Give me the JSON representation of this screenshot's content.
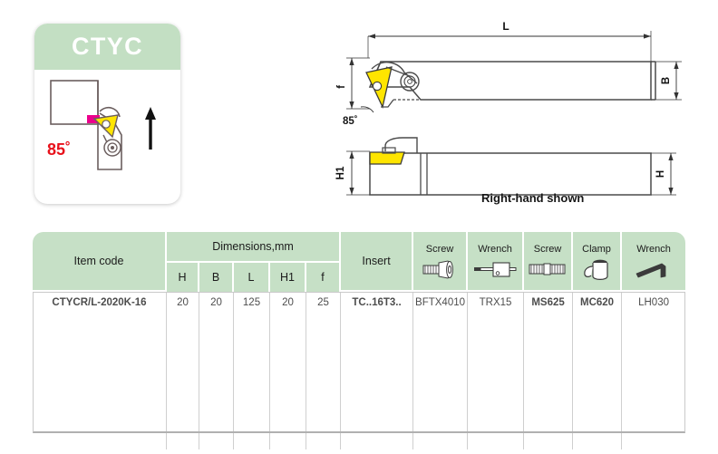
{
  "product": {
    "code_badge": "CTYC",
    "lead_angle": "85˚",
    "view_caption": "Right-hand shown",
    "drawing_angle_label": "85˚"
  },
  "drawing_labels": {
    "length": "L",
    "width": "B",
    "height": "H",
    "height1": "H1",
    "f": "f"
  },
  "table": {
    "header": {
      "item_code": "Item code",
      "dimensions_group": "Dimensions,mm",
      "dim_cols": [
        "H",
        "B",
        "L",
        "H1",
        "f"
      ],
      "insert": "Insert",
      "tools": [
        {
          "label": "Screw",
          "icon": "screw-head-icon"
        },
        {
          "label": "Wrench",
          "icon": "torx-driver-icon"
        },
        {
          "label": "Screw",
          "icon": "double-thread-screw-icon"
        },
        {
          "label": "Clamp",
          "icon": "clamp-icon"
        },
        {
          "label": "Wrench",
          "icon": "hex-key-icon"
        }
      ]
    },
    "rows": [
      {
        "item_code": "CTYCR/L-2020K-16",
        "H": "20",
        "B": "20",
        "L": "125",
        "H1": "20",
        "f": "25",
        "insert": "TC..16T3..",
        "screw": "BFTX4010",
        "wrench": "TRX15",
        "screw2": "MS625",
        "clamp": "MC620",
        "wrench2": "LH030"
      }
    ],
    "empty_rows": 5
  },
  "colors": {
    "header_green": "#c6e0c6",
    "badge_green": "#c3dfc3",
    "angle_red": "#e8111b",
    "insert_yellow": "#ffe500",
    "highlight_magenta": "#ec008c",
    "line_grey": "#4a4a4a"
  }
}
